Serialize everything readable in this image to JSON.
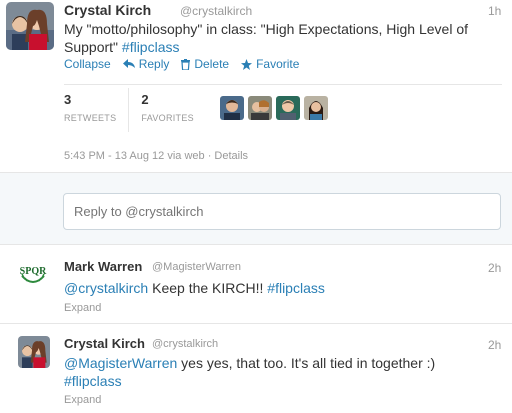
{
  "main_tweet": {
    "name": "Crystal Kirch",
    "handle": "@crystalkirch",
    "time": "1h",
    "text_line1": "My \"motto/philosophy\" in class: \"High Expectations, High Level of",
    "text_line2_pre": "Support\" ",
    "hashtag": "#flipclass",
    "actions": {
      "collapse": "Collapse",
      "reply": "Reply",
      "delete": "Delete",
      "favorite": "Favorite"
    },
    "stats": {
      "retweets_count": "3",
      "retweets_label": "RETWEETS",
      "favorites_count": "2",
      "favorites_label": "FAVORITES"
    },
    "meta": "5:43 PM - 13 Aug 12 via web · Details"
  },
  "reply_box": {
    "placeholder": "Reply to @crystalkirch"
  },
  "replies": [
    {
      "name": "Mark Warren",
      "handle": "@MagisterWarren",
      "time": "2h",
      "mention": "@crystalkirch",
      "text": " Keep the KIRCH!! ",
      "hashtag": "#flipclass",
      "expand": "Expand",
      "avatar_text": "SPQR"
    },
    {
      "name": "Crystal Kirch",
      "handle": "@crystalkirch",
      "time": "2h",
      "mention": "@MagisterWarren",
      "text": " yes yes, that too. It's all tied in together :)",
      "hashtag": "#flipclass",
      "expand": "Expand"
    }
  ],
  "colors": {
    "link": "#2a7fb5",
    "muted": "#999999",
    "text": "#333333"
  }
}
